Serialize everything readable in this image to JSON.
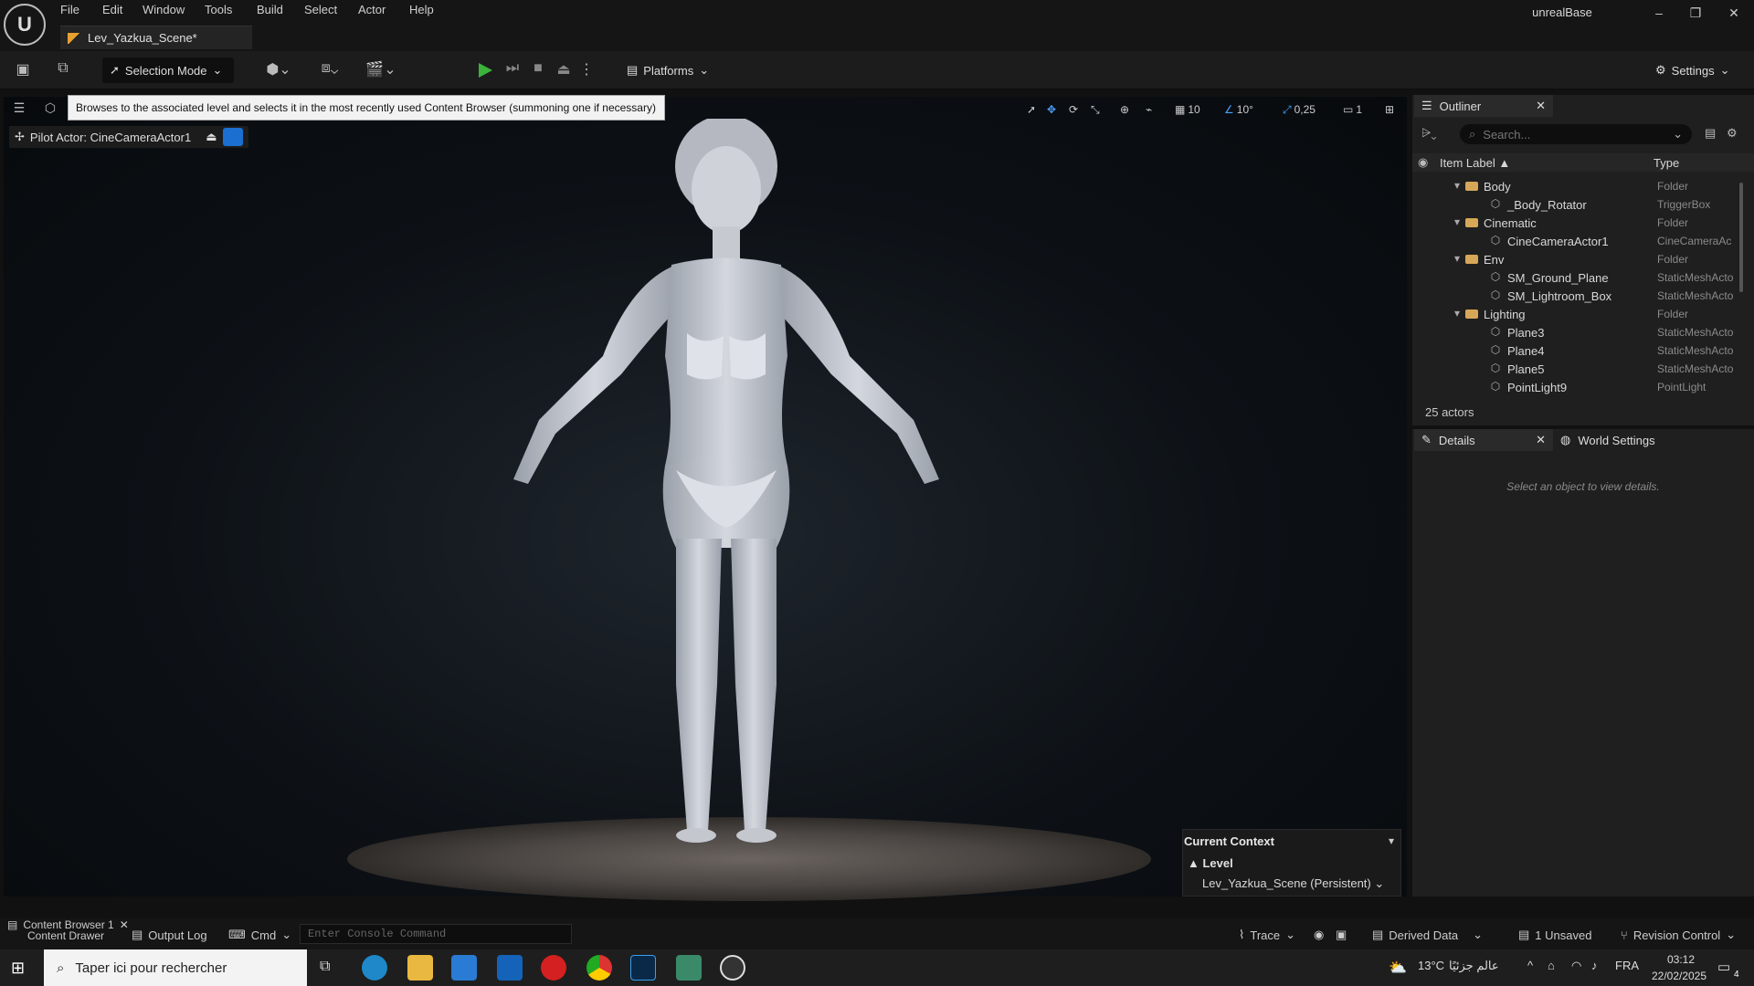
{
  "window": {
    "app_name": "unrealBase",
    "doc_tab": "Lev_Yazkua_Scene*",
    "logo_text": "U"
  },
  "menu": [
    "File",
    "Edit",
    "Window",
    "Tools",
    "Build",
    "Select",
    "Actor",
    "Help"
  ],
  "toolbar": {
    "selection_mode": "Selection Mode",
    "platforms": "Platforms",
    "settings": "Settings"
  },
  "viewport": {
    "tooltip": "Browses to the associated level and selects it in the most recently used Content Browser (summoning one if necessary)",
    "pilot_actor": "Pilot Actor: CineCameraActor1",
    "grid_snap": "10",
    "rotation_snap": "10°",
    "scale_snap": "0,25",
    "camera_speed": "1"
  },
  "context": {
    "title": "Current Context",
    "level_label": "Level",
    "level_name": "Lev_Yazkua_Scene (Persistent)"
  },
  "outliner": {
    "tab": "Outliner",
    "search_placeholder": "Search...",
    "col_label": "Item Label ▲",
    "col_type": "Type",
    "rows": [
      {
        "label": "Body",
        "type": "Folder",
        "folder": true,
        "indent": 0
      },
      {
        "label": "_Body_Rotator",
        "type": "TriggerBox",
        "folder": false,
        "indent": 1
      },
      {
        "label": "Cinematic",
        "type": "Folder",
        "folder": true,
        "indent": 0
      },
      {
        "label": "CineCameraActor1",
        "type": "CineCameraAc",
        "folder": false,
        "indent": 1
      },
      {
        "label": "Env",
        "type": "Folder",
        "folder": true,
        "indent": 0
      },
      {
        "label": "SM_Ground_Plane",
        "type": "StaticMeshActo",
        "folder": false,
        "indent": 1
      },
      {
        "label": "SM_Lightroom_Box",
        "type": "StaticMeshActo",
        "folder": false,
        "indent": 1
      },
      {
        "label": "Lighting",
        "type": "Folder",
        "folder": true,
        "indent": 0
      },
      {
        "label": "Plane3",
        "type": "StaticMeshActo",
        "folder": false,
        "indent": 1
      },
      {
        "label": "Plane4",
        "type": "StaticMeshActo",
        "folder": false,
        "indent": 1
      },
      {
        "label": "Plane5",
        "type": "StaticMeshActo",
        "folder": false,
        "indent": 1
      },
      {
        "label": "PointLight9",
        "type": "PointLight",
        "folder": false,
        "indent": 1
      }
    ],
    "actor_count": "25 actors"
  },
  "details": {
    "tab": "Details",
    "world_tab": "World Settings",
    "empty_text": "Select an object to view details."
  },
  "statusbar": {
    "content_browser": "Content Browser 1",
    "content_drawer": "Content Drawer",
    "output_log": "Output Log",
    "cmd": "Cmd",
    "console_placeholder": "Enter Console Command",
    "trace": "Trace",
    "derived_data": "Derived Data",
    "unsaved": "1 Unsaved",
    "revision": "Revision Control"
  },
  "taskbar": {
    "search_placeholder": "Taper ici pour rechercher",
    "weather": "13°C",
    "weather_text": "عالم جزئيًا",
    "lang": "FRA",
    "time": "03:12",
    "date": "22/02/2025",
    "notifications": "4"
  }
}
